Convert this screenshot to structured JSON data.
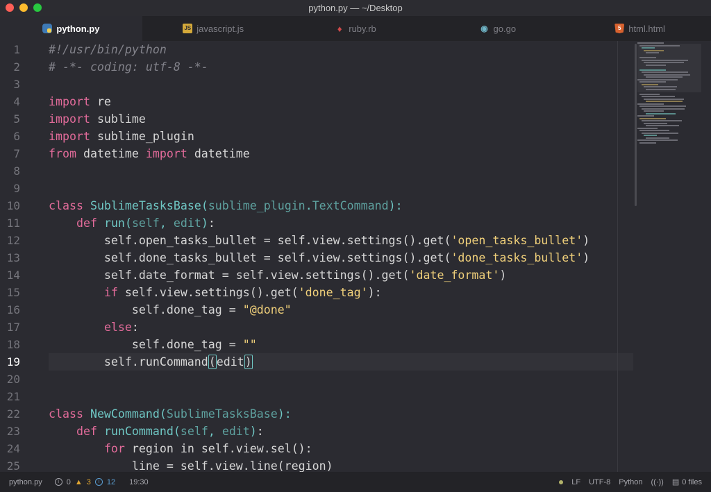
{
  "window": {
    "title": "python.py — ~/Desktop"
  },
  "tabs": [
    {
      "label": "python.py",
      "icon": "python-icon",
      "active": true
    },
    {
      "label": "javascript.js",
      "icon": "javascript-icon",
      "active": false
    },
    {
      "label": "ruby.rb",
      "icon": "ruby-icon",
      "active": false
    },
    {
      "label": "go.go",
      "icon": "go-icon",
      "active": false
    },
    {
      "label": "html.html",
      "icon": "html5-icon",
      "active": false
    }
  ],
  "editor": {
    "current_line": 19,
    "line_numbers": [
      "1",
      "2",
      "3",
      "4",
      "5",
      "6",
      "7",
      "8",
      "9",
      "10",
      "11",
      "12",
      "13",
      "14",
      "15",
      "16",
      "17",
      "18",
      "19",
      "20",
      "21",
      "22",
      "23",
      "24",
      "25"
    ],
    "lines": [
      "#!/usr/bin/python",
      "# -*- coding: utf-8 -*-",
      "",
      "import re",
      "import sublime",
      "import sublime_plugin",
      "from datetime import datetime",
      "",
      "",
      "class SublimeTasksBase(sublime_plugin.TextCommand):",
      "    def run(self, edit):",
      "        self.open_tasks_bullet = self.view.settings().get('open_tasks_bullet')",
      "        self.done_tasks_bullet = self.view.settings().get('done_tasks_bullet')",
      "        self.date_format = self.view.settings().get('date_format')",
      "        if self.view.settings().get('done_tag'):",
      "            self.done_tag = \"@done\"",
      "        else:",
      "            self.done_tag = \"\"",
      "        self.runCommand(edit)",
      "",
      "",
      "class NewCommand(SublimeTasksBase):",
      "    def runCommand(self, edit):",
      "        for region in self.view.sel():",
      "            line = self.view.line(region)"
    ]
  },
  "status": {
    "file": "python.py",
    "errors": "0",
    "warnings": "3",
    "infos": "12",
    "cursor": "19:30",
    "line_ending": "LF",
    "encoding": "UTF-8",
    "grammar": "Python",
    "files": "0 files",
    "colors": {
      "warning": "#e0a632",
      "info": "#5b9fd3",
      "keyword": "#e26b9a",
      "class": "#6fc7c4",
      "string": "#efcf7a"
    }
  }
}
